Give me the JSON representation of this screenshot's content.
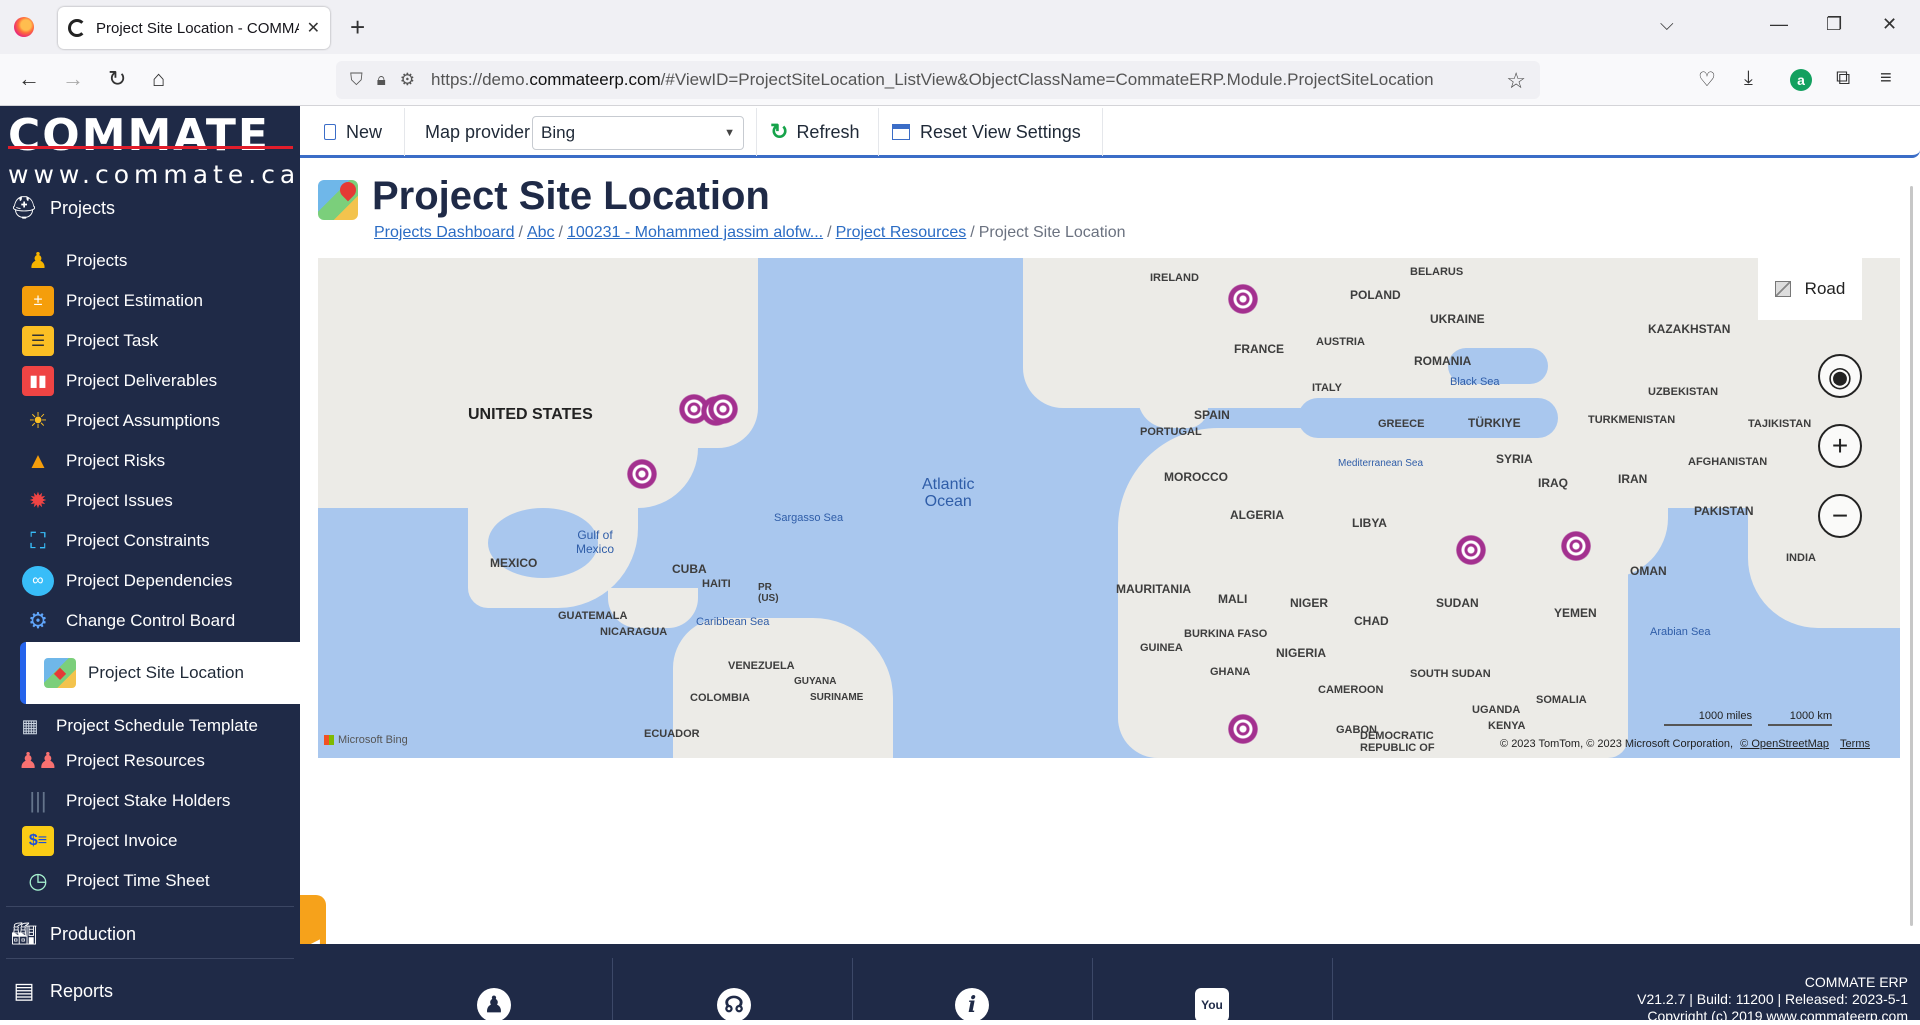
{
  "browser": {
    "tab_title": "Project Site Location - COMMATE",
    "url_prefix": "https://demo.",
    "url_domain": "commateerp.com",
    "url_suffix": "/#ViewID=ProjectSiteLocation_ListView&ObjectClassName=CommateERP.Module.ProjectSiteLocation"
  },
  "logo": {
    "main": "COMMATE",
    "sub": "www.commate.ca"
  },
  "sidebar": {
    "section_projects": "Projects",
    "items": [
      {
        "label": "Projects",
        "icon": "person-icon"
      },
      {
        "label": "Project Estimation",
        "icon": "calculator-icon"
      },
      {
        "label": "Project Task",
        "icon": "task-list-icon"
      },
      {
        "label": "Project Deliverables",
        "icon": "deliverables-icon"
      },
      {
        "label": "Project Assumptions",
        "icon": "lightbulb-icon"
      },
      {
        "label": "Project Risks",
        "icon": "risk-cone-icon"
      },
      {
        "label": "Project Issues",
        "icon": "bug-icon"
      },
      {
        "label": "Project Constraints",
        "icon": "constraints-icon"
      },
      {
        "label": "Project Dependencies",
        "icon": "link-icon"
      },
      {
        "label": "Change Control Board",
        "icon": "board-icon"
      },
      {
        "label": "Project Site Location",
        "icon": "map-icon"
      },
      {
        "label": "Project Schedule Template",
        "icon": "schedule-icon"
      },
      {
        "label": "Project Resources",
        "icon": "team-icon"
      },
      {
        "label": "Project Stake Holders",
        "icon": "stakeholders-icon"
      },
      {
        "label": "Project Invoice",
        "icon": "invoice-icon"
      },
      {
        "label": "Project Time Sheet",
        "icon": "timesheet-icon"
      }
    ],
    "section_production": "Production",
    "section_reports": "Reports"
  },
  "toolbar": {
    "new_label": "New",
    "map_provider_label": "Map provider",
    "map_provider_value": "Bing",
    "refresh_label": "Refresh",
    "reset_label": "Reset View Settings"
  },
  "page": {
    "title": "Project Site Location",
    "breadcrumb": {
      "b1": "Projects Dashboard",
      "b2": "Abc",
      "b3": "100231 - Mohammed jassim alofw...",
      "b4": "Project Resources",
      "current": "Project Site Location",
      "separator": "/"
    }
  },
  "map": {
    "road_label": "Road",
    "labels": {
      "us": "UNITED STATES",
      "mexico": "MEXICO",
      "cuba": "CUBA",
      "haiti": "HAITI",
      "pr": "PR\n(US)",
      "guatemala": "GUATEMALA",
      "nicaragua": "NICARAGUA",
      "venezuela": "VENEZUELA",
      "guyana": "GUYANA",
      "suriname": "SURINAME",
      "colombia": "COLOMBIA",
      "ecuador": "ECUADOR",
      "gulf": "Gulf of\nMexico",
      "sargasso": "Sargasso Sea",
      "caribbean": "Caribbean Sea",
      "atlantic": "Atlantic\nOcean",
      "ireland": "IRELAND",
      "france": "FRANCE",
      "spain": "SPAIN",
      "portugal": "PORTUGAL",
      "italy": "ITALY",
      "austria": "AUSTRIA",
      "poland": "POLAND",
      "belarus": "BELARUS",
      "ukraine": "UKRAINE",
      "romania": "ROMANIA",
      "greece": "GREECE",
      "turkiye": "TÜRKIYE",
      "blacksea": "Black Sea",
      "medsea": "Mediterranean Sea",
      "kazakhstan": "KAZAKHSTAN",
      "uzbekistan": "UZBEKISTAN",
      "turkmenistan": "TURKMENISTAN",
      "tajikistan": "TAJIKISTAN",
      "syria": "SYRIA",
      "iraq": "IRAQ",
      "iran": "IRAN",
      "afghanistan": "AFGHANISTAN",
      "pakistan": "PAKISTAN",
      "india": "INDIA",
      "oman": "OMAN",
      "yemen": "YEMEN",
      "arabiansea": "Arabian Sea",
      "morocco": "MOROCCO",
      "algeria": "ALGERIA",
      "libya": "LIBYA",
      "mauritania": "MAURITANIA",
      "mali": "MALI",
      "niger": "NIGER",
      "chad": "CHAD",
      "sudan": "SUDAN",
      "burkina": "BURKINA FASO",
      "guinea": "GUINEA",
      "ghana": "GHANA",
      "nigeria": "NIGERIA",
      "cameroon": "CAMEROON",
      "southsudan": "SOUTH SUDAN",
      "uganda": "UGANDA",
      "kenya": "KENYA",
      "somalia": "SOMALIA",
      "gabon": "GABON",
      "drc": "DEMOCRATIC\nREPUBLIC OF"
    },
    "scale_miles": "1000 miles",
    "scale_km": "1000 km",
    "attribution": "© 2023 TomTom, © 2023 Microsoft Corporation,",
    "osm": "© OpenStreetMap",
    "terms": "Terms",
    "provider_logo": "Microsoft Bing"
  },
  "footer": {
    "product": "COMMATE ERP",
    "version": "V21.2.7 | Build: 11200 | Released: 2023-5-1",
    "copyright": "Copyright (c) 2019 www.commateerp.com"
  }
}
